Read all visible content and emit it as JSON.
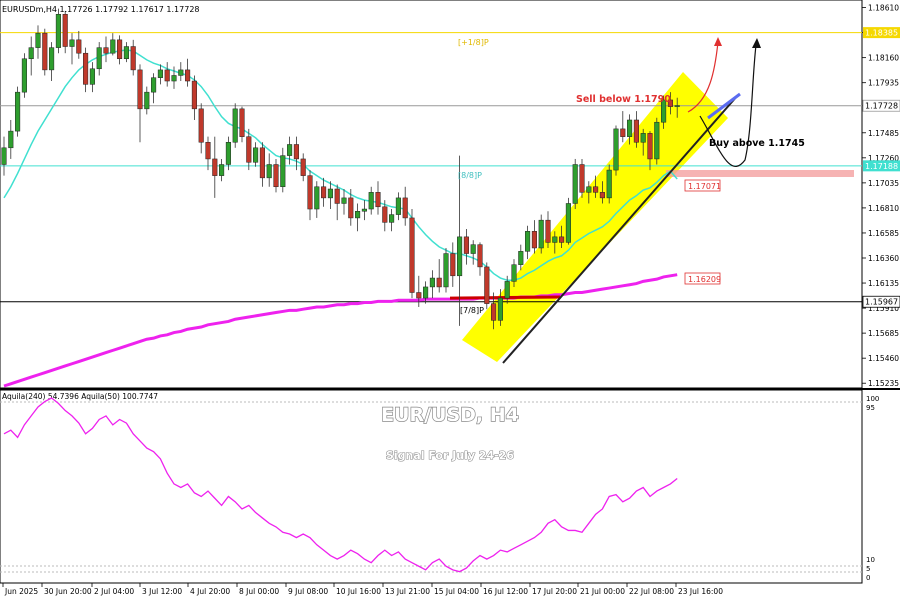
{
  "header": {
    "symbol_info": "EURUSDm,H4  1.17726 1.17792 1.17617 1.17728"
  },
  "price_axis": {
    "ticks": [
      "1.18610",
      "1.18385",
      "1.18160",
      "1.17935",
      "1.17728",
      "1.17485",
      "1.17260",
      "1.17035",
      "1.16810",
      "1.16585",
      "1.16360",
      "1.16135",
      "1.15910",
      "1.15685",
      "1.15460",
      "1.15235"
    ],
    "tick_values": [
      1.1861,
      1.18385,
      1.1816,
      1.17935,
      1.17728,
      1.17485,
      1.1726,
      1.17035,
      1.1681,
      1.16585,
      1.1636,
      1.16135,
      1.1591,
      1.15685,
      1.1546,
      1.15235
    ],
    "level_labels": {
      "top_yellow": "1.18385",
      "current": "1.17728",
      "cyan": "1.17188",
      "bottom": "1.15967"
    }
  },
  "time_axis": {
    "labels": [
      "Jun 2025",
      "30 Jun 20:00",
      "2 Jul 04:00",
      "3 Jul 12:00",
      "4 Jul 20:00",
      "8 Jul 00:00",
      "9 Jul 08:00",
      "10 Jul 16:00",
      "13 Jul 21:00",
      "15 Jul 04:00",
      "16 Jul 12:00",
      "17 Jul 20:00",
      "21 Jul 00:00",
      "22 Jul 08:00",
      "23 Jul 16:00"
    ]
  },
  "murrey_labels": {
    "top": "[+1/8]P",
    "mid": "[8/8]P",
    "low": "[7/8]P"
  },
  "annotations": {
    "sell": "Sell below 1.1790",
    "buy": "Buy above 1.1745",
    "ma_label_1": "1.17071",
    "ma_label_2": "1.16209"
  },
  "indicator": {
    "header": "Aquila(240) 54.7396  Aquila(50) 100.7747",
    "ticks": [
      "100",
      "95",
      "10",
      "5",
      "0"
    ]
  },
  "watermark": {
    "title": "EUR/USD, H4",
    "subtitle": "Signal For July 24-26"
  },
  "colors": {
    "bull": "#2e9e2e",
    "bear": "#c0392b",
    "ma_fast": "#40e0d0",
    "ma_slow": "#ee22ee",
    "channel": "#ffff00",
    "sell_arrow": "#e03030",
    "buy_arrow": "#111111",
    "trendline": "#5b6cf0"
  },
  "chart_data": {
    "type": "candlestick",
    "ylim": [
      1.1521,
      1.1866
    ],
    "levels": [
      1.18385,
      1.17728,
      1.17188,
      1.15967
    ],
    "candles": [
      [
        1.172,
        1.1745,
        1.171,
        1.1735
      ],
      [
        1.1735,
        1.176,
        1.1725,
        1.175
      ],
      [
        1.175,
        1.179,
        1.1745,
        1.1785
      ],
      [
        1.1785,
        1.182,
        1.178,
        1.1815
      ],
      [
        1.1815,
        1.1835,
        1.18,
        1.1825
      ],
      [
        1.1825,
        1.1845,
        1.1815,
        1.1838
      ],
      [
        1.1838,
        1.1842,
        1.18,
        1.1805
      ],
      [
        1.1805,
        1.183,
        1.1795,
        1.1825
      ],
      [
        1.1825,
        1.186,
        1.182,
        1.1855
      ],
      [
        1.1855,
        1.1858,
        1.182,
        1.1826
      ],
      [
        1.1826,
        1.1838,
        1.181,
        1.1832
      ],
      [
        1.1832,
        1.184,
        1.1815,
        1.182
      ],
      [
        1.182,
        1.1825,
        1.1785,
        1.1792
      ],
      [
        1.1792,
        1.1812,
        1.1785,
        1.1806
      ],
      [
        1.1806,
        1.183,
        1.18,
        1.1825
      ],
      [
        1.1825,
        1.1835,
        1.1812,
        1.182
      ],
      [
        1.182,
        1.1838,
        1.1818,
        1.1832
      ],
      [
        1.1832,
        1.1836,
        1.181,
        1.1815
      ],
      [
        1.1815,
        1.183,
        1.1812,
        1.1826
      ],
      [
        1.1826,
        1.1832,
        1.18,
        1.1805
      ],
      [
        1.1805,
        1.181,
        1.174,
        1.177
      ],
      [
        1.177,
        1.179,
        1.1765,
        1.1785
      ],
      [
        1.1785,
        1.1802,
        1.1775,
        1.1798
      ],
      [
        1.1798,
        1.181,
        1.1792,
        1.1805
      ],
      [
        1.1805,
        1.1812,
        1.179,
        1.1795
      ],
      [
        1.1795,
        1.1808,
        1.1788,
        1.18
      ],
      [
        1.18,
        1.1812,
        1.1795,
        1.1805
      ],
      [
        1.1805,
        1.1815,
        1.179,
        1.1795
      ],
      [
        1.1795,
        1.18,
        1.176,
        1.177
      ],
      [
        1.177,
        1.1775,
        1.173,
        1.174
      ],
      [
        1.174,
        1.1745,
        1.1715,
        1.1725
      ],
      [
        1.1725,
        1.1745,
        1.169,
        1.171
      ],
      [
        1.171,
        1.1725,
        1.1705,
        1.172
      ],
      [
        1.172,
        1.1745,
        1.1715,
        1.174
      ],
      [
        1.174,
        1.1775,
        1.1735,
        1.177
      ],
      [
        1.177,
        1.1772,
        1.174,
        1.1745
      ],
      [
        1.1745,
        1.1752,
        1.1715,
        1.1722
      ],
      [
        1.1722,
        1.174,
        1.1718,
        1.1735
      ],
      [
        1.1735,
        1.174,
        1.17,
        1.1708
      ],
      [
        1.1708,
        1.173,
        1.17,
        1.172
      ],
      [
        1.172,
        1.1725,
        1.1695,
        1.17
      ],
      [
        1.17,
        1.1735,
        1.1695,
        1.1728
      ],
      [
        1.1728,
        1.1745,
        1.172,
        1.1738
      ],
      [
        1.1738,
        1.1745,
        1.1715,
        1.1725
      ],
      [
        1.1725,
        1.173,
        1.1705,
        1.171
      ],
      [
        1.171,
        1.1715,
        1.167,
        1.168
      ],
      [
        1.168,
        1.1705,
        1.1672,
        1.17
      ],
      [
        1.17,
        1.1708,
        1.1682,
        1.169
      ],
      [
        1.169,
        1.1705,
        1.168,
        1.1698
      ],
      [
        1.1698,
        1.1702,
        1.167,
        1.1685
      ],
      [
        1.1685,
        1.1698,
        1.1675,
        1.169
      ],
      [
        1.169,
        1.1698,
        1.1665,
        1.1672
      ],
      [
        1.1672,
        1.1685,
        1.166,
        1.1678
      ],
      [
        1.1678,
        1.1688,
        1.167,
        1.168
      ],
      [
        1.168,
        1.17,
        1.1675,
        1.1695
      ],
      [
        1.1695,
        1.1705,
        1.1675,
        1.1682
      ],
      [
        1.1682,
        1.1688,
        1.166,
        1.1668
      ],
      [
        1.1668,
        1.168,
        1.166,
        1.1675
      ],
      [
        1.1675,
        1.1695,
        1.167,
        1.169
      ],
      [
        1.169,
        1.17,
        1.1665,
        1.1672
      ],
      [
        1.1672,
        1.168,
        1.16,
        1.1605
      ],
      [
        1.1605,
        1.162,
        1.1592,
        1.16
      ],
      [
        1.16,
        1.1615,
        1.1595,
        1.161
      ],
      [
        1.161,
        1.1625,
        1.16,
        1.1618
      ],
      [
        1.1618,
        1.1635,
        1.1605,
        1.161
      ],
      [
        1.161,
        1.1645,
        1.1605,
        1.164
      ],
      [
        1.164,
        1.165,
        1.161,
        1.162
      ],
      [
        1.162,
        1.1728,
        1.1575,
        1.1655
      ],
      [
        1.1655,
        1.1662,
        1.163,
        1.164
      ],
      [
        1.164,
        1.1652,
        1.163,
        1.1648
      ],
      [
        1.1648,
        1.165,
        1.162,
        1.1628
      ],
      [
        1.1628,
        1.1632,
        1.159,
        1.1595
      ],
      [
        1.1595,
        1.1605,
        1.1572,
        1.158
      ],
      [
        1.158,
        1.1608,
        1.1575,
        1.16
      ],
      [
        1.16,
        1.162,
        1.1595,
        1.1615
      ],
      [
        1.1615,
        1.1635,
        1.161,
        1.163
      ],
      [
        1.163,
        1.1648,
        1.1625,
        1.1642
      ],
      [
        1.1642,
        1.1665,
        1.1635,
        1.166
      ],
      [
        1.166,
        1.167,
        1.164,
        1.1645
      ],
      [
        1.1645,
        1.1675,
        1.164,
        1.167
      ],
      [
        1.167,
        1.1678,
        1.1645,
        1.165
      ],
      [
        1.165,
        1.166,
        1.164,
        1.1655
      ],
      [
        1.1655,
        1.1665,
        1.1645,
        1.165
      ],
      [
        1.165,
        1.169,
        1.1648,
        1.1685
      ],
      [
        1.1685,
        1.1725,
        1.168,
        1.172
      ],
      [
        1.172,
        1.1725,
        1.169,
        1.1695
      ],
      [
        1.1695,
        1.1705,
        1.1685,
        1.17
      ],
      [
        1.17,
        1.171,
        1.169,
        1.1695
      ],
      [
        1.1695,
        1.1705,
        1.1685,
        1.169
      ],
      [
        1.169,
        1.172,
        1.1685,
        1.1715
      ],
      [
        1.1715,
        1.1755,
        1.171,
        1.1752
      ],
      [
        1.1752,
        1.1768,
        1.174,
        1.1745
      ],
      [
        1.1745,
        1.1765,
        1.1738,
        1.176
      ],
      [
        1.176,
        1.1768,
        1.1735,
        1.174
      ],
      [
        1.174,
        1.1752,
        1.1728,
        1.1748
      ],
      [
        1.1748,
        1.175,
        1.1715,
        1.1725
      ],
      [
        1.1725,
        1.1762,
        1.172,
        1.1758
      ],
      [
        1.1758,
        1.1782,
        1.1752,
        1.1778
      ],
      [
        1.1778,
        1.1785,
        1.1765,
        1.1772
      ],
      [
        1.1772,
        1.178,
        1.1762,
        1.1773
      ]
    ],
    "ma_fast": [
      1.169,
      1.17,
      1.1712,
      1.1725,
      1.1738,
      1.175,
      1.176,
      1.177,
      1.178,
      1.179,
      1.1798,
      1.1805,
      1.181,
      1.1814,
      1.1817,
      1.1819,
      1.1821,
      1.1822,
      1.1823,
      1.1822,
      1.1818,
      1.1814,
      1.1811,
      1.1809,
      1.1806,
      1.1804,
      1.1802,
      1.18,
      1.1796,
      1.179,
      1.1782,
      1.1772,
      1.1763,
      1.1757,
      1.1754,
      1.1752,
      1.1748,
      1.1744,
      1.1738,
      1.1733,
      1.1728,
      1.1726,
      1.1725,
      1.1723,
      1.172,
      1.1714,
      1.171,
      1.1706,
      1.1703,
      1.17,
      1.1697,
      1.1693,
      1.169,
      1.1688,
      1.1687,
      1.1686,
      1.1684,
      1.1682,
      1.1681,
      1.168,
      1.1672,
      1.1664,
      1.1657,
      1.1651,
      1.1646,
      1.1643,
      1.164,
      1.164,
      1.1638,
      1.1636,
      1.1633,
      1.1628,
      1.1622,
      1.1618,
      1.1616,
      1.1616,
      1.1618,
      1.1622,
      1.1625,
      1.1629,
      1.1633,
      1.1636,
      1.1638,
      1.1643,
      1.165,
      1.1654,
      1.1658,
      1.1661,
      1.1664,
      1.1669,
      1.1676,
      1.1682,
      1.1688,
      1.1692,
      1.1697,
      1.1699,
      1.1704,
      1.171,
      1.1714,
      1.1707
    ],
    "ma_slow": [
      1.1521,
      1.1523,
      1.1525,
      1.1527,
      1.1529,
      1.1531,
      1.1533,
      1.1535,
      1.1537,
      1.1539,
      1.1541,
      1.1543,
      1.1545,
      1.1547,
      1.1549,
      1.1551,
      1.1553,
      1.1555,
      1.1557,
      1.1559,
      1.1561,
      1.1563,
      1.1564,
      1.1566,
      1.1567,
      1.1569,
      1.157,
      1.1572,
      1.1573,
      1.1574,
      1.1576,
      1.1577,
      1.1578,
      1.1579,
      1.1581,
      1.1582,
      1.1583,
      1.1584,
      1.1585,
      1.1586,
      1.1587,
      1.1588,
      1.1589,
      1.1589,
      1.159,
      1.1591,
      1.1592,
      1.1592,
      1.1593,
      1.1594,
      1.1594,
      1.1595,
      1.1595,
      1.1596,
      1.1596,
      1.1597,
      1.1597,
      1.1597,
      1.1598,
      1.1598,
      1.1598,
      1.1598,
      1.1599,
      1.1599,
      1.1599,
      1.1599,
      1.1599,
      1.1599,
      1.1599,
      1.1599,
      1.16,
      1.16,
      1.16,
      1.16,
      1.16,
      1.16,
      1.1601,
      1.1601,
      1.1601,
      1.1602,
      1.1602,
      1.1603,
      1.1603,
      1.1604,
      1.1605,
      1.1605,
      1.1606,
      1.1607,
      1.1608,
      1.1609,
      1.161,
      1.1611,
      1.1612,
      1.1613,
      1.1615,
      1.1616,
      1.1617,
      1.1619,
      1.162,
      1.1621
    ],
    "osc_ylim": [
      0,
      100
    ],
    "oscillator": [
      80,
      82,
      78,
      85,
      90,
      95,
      98,
      100,
      97,
      93,
      90,
      86,
      80,
      83,
      88,
      90,
      85,
      88,
      86,
      80,
      76,
      72,
      70,
      66,
      58,
      52,
      50,
      52,
      47,
      45,
      48,
      44,
      40,
      45,
      42,
      38,
      40,
      36,
      33,
      30,
      28,
      25,
      24,
      22,
      24,
      22,
      18,
      15,
      12,
      10,
      12,
      15,
      13,
      10,
      8,
      12,
      15,
      12,
      14,
      10,
      8,
      6,
      4,
      8,
      10,
      6,
      4,
      3,
      5,
      9,
      12,
      10,
      12,
      15,
      14,
      16,
      18,
      20,
      22,
      25,
      30,
      32,
      28,
      26,
      26,
      25,
      30,
      35,
      38,
      45,
      46,
      42,
      44,
      48,
      50,
      45,
      48,
      50,
      52,
      55
    ]
  }
}
